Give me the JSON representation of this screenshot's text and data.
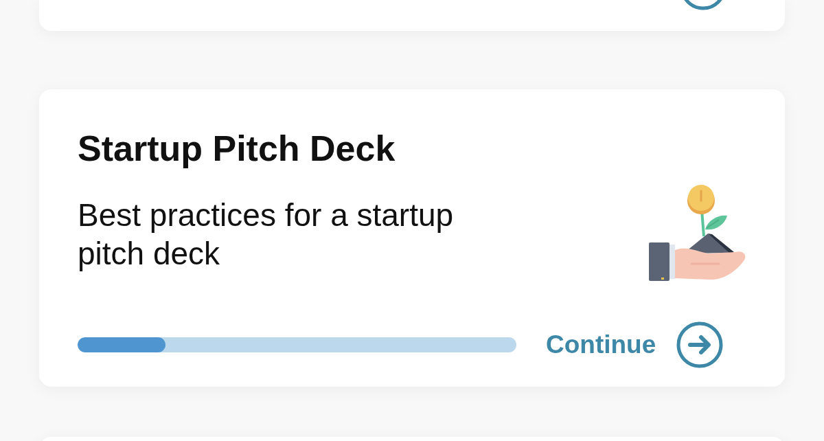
{
  "course": {
    "title": "Startup Pitch Deck",
    "description": "Best practices for a startup pitch deck",
    "progress": {
      "level": 0.2
    },
    "action": {
      "label": "Continue"
    }
  }
}
